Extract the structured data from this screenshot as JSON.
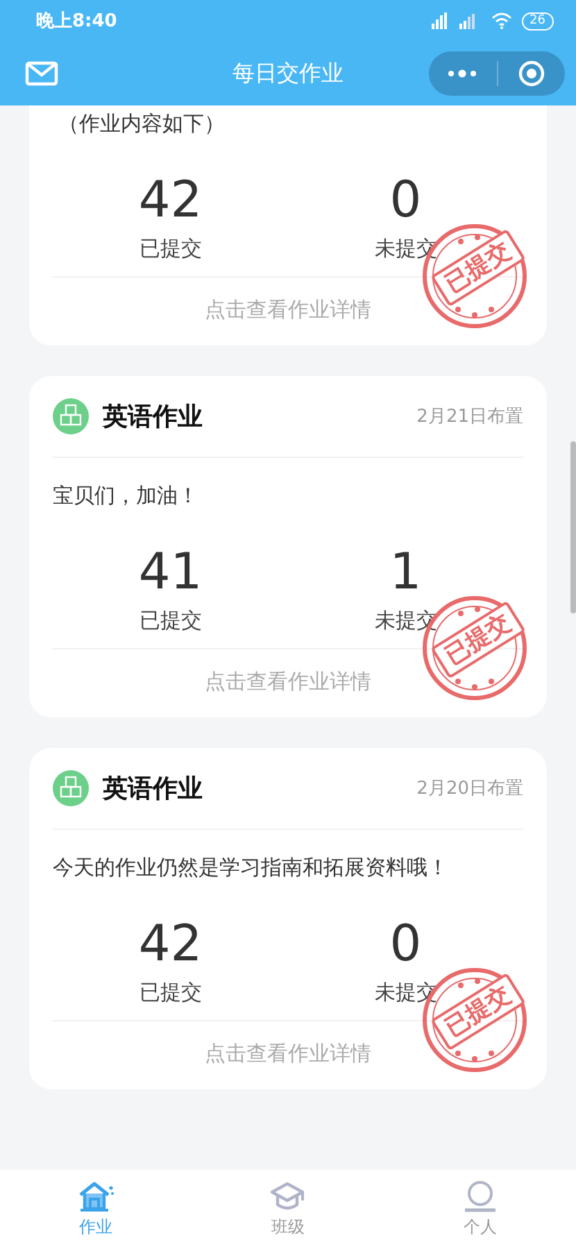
{
  "status_bar": {
    "time": "晚上8:40",
    "battery": "26"
  },
  "nav_bar": {
    "title": "每日交作业"
  },
  "cards": [
    {
      "kind": "partial",
      "note": "（作业内容如下）",
      "submitted": "42",
      "submitted_label": "已提交",
      "unsubmitted": "0",
      "unsubmitted_label": "未提交",
      "stamp": "已提交",
      "link": "点击查看作业详情"
    },
    {
      "kind": "full",
      "title": "英语作业",
      "date": "2月21日布置",
      "note": "宝贝们，加油！",
      "submitted": "41",
      "submitted_label": "已提交",
      "unsubmitted": "1",
      "unsubmitted_label": "未提交",
      "stamp": "已提交",
      "link": "点击查看作业详情"
    },
    {
      "kind": "full",
      "title": "英语作业",
      "date": "2月20日布置",
      "note": "今天的作业仍然是学习指南和拓展资料哦！",
      "submitted": "42",
      "submitted_label": "已提交",
      "unsubmitted": "0",
      "unsubmitted_label": "未提交",
      "stamp": "已提交",
      "link": "点击查看作业详情"
    }
  ],
  "tab_bar": [
    {
      "label": "作业",
      "selected": true
    },
    {
      "label": "班级",
      "selected": false
    },
    {
      "label": "个人",
      "selected": false
    }
  ]
}
